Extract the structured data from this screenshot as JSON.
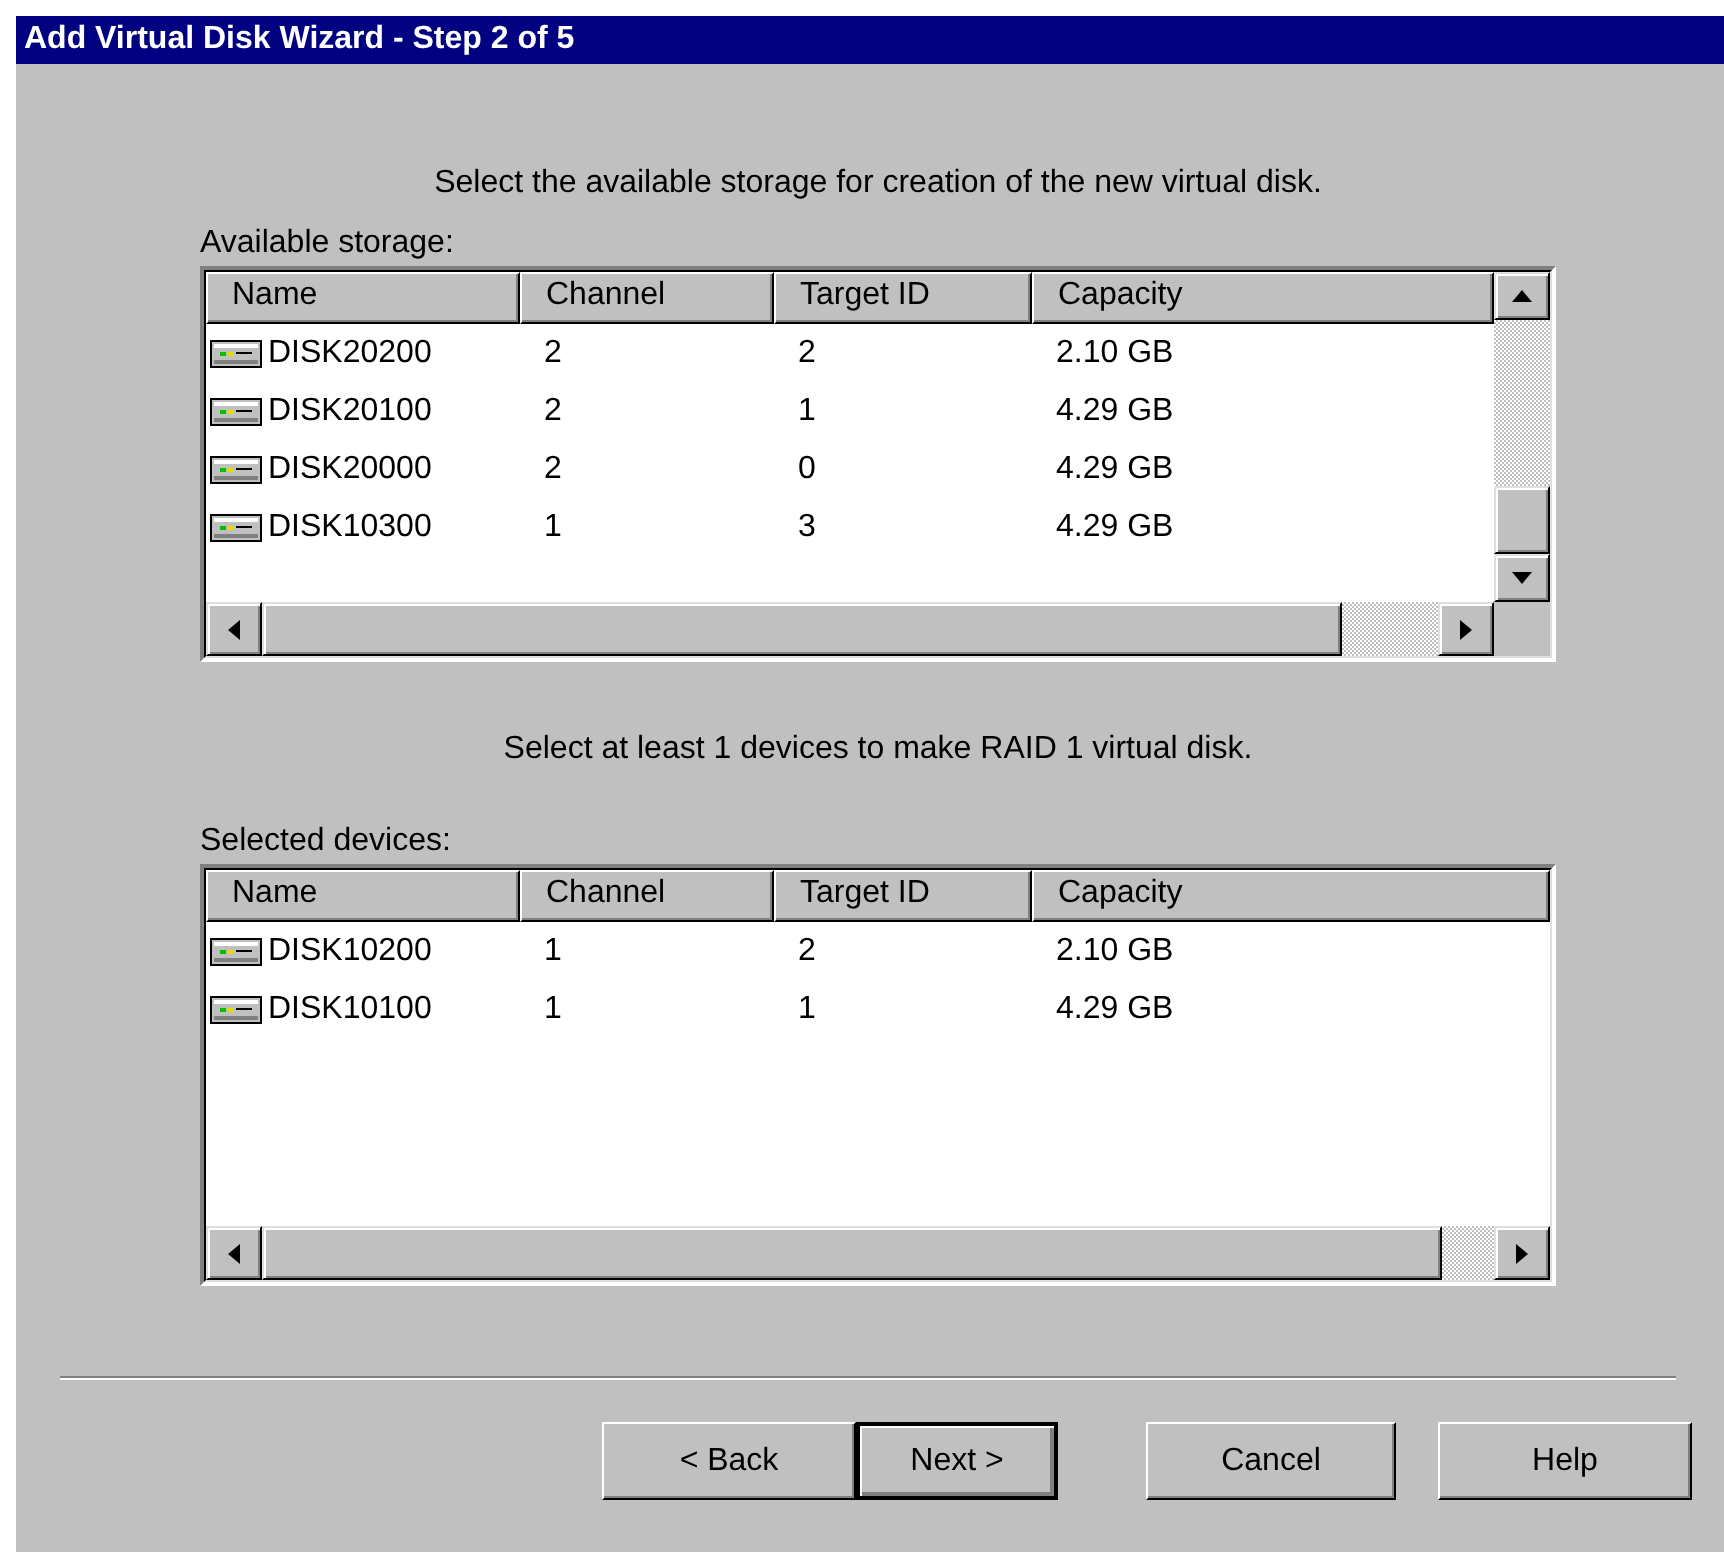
{
  "window": {
    "title": "Add Virtual Disk Wizard - Step 2 of 5"
  },
  "instruction": "Select the available storage for creation of the new virtual disk.",
  "available_storage": {
    "label": "Available storage:",
    "vertical_scrollbar": true,
    "columns": [
      "Name",
      "Channel",
      "Target ID",
      "Capacity"
    ],
    "rows": [
      {
        "name": "DISK20200",
        "channel": "2",
        "target_id": "2",
        "capacity": "2.10 GB"
      },
      {
        "name": "DISK20100",
        "channel": "2",
        "target_id": "1",
        "capacity": "4.29 GB"
      },
      {
        "name": "DISK20000",
        "channel": "2",
        "target_id": "0",
        "capacity": "4.29 GB"
      },
      {
        "name": "DISK10300",
        "channel": "1",
        "target_id": "3",
        "capacity": "4.29 GB"
      }
    ]
  },
  "hint": "Select at least 1 devices to make RAID 1 virtual disk.",
  "selected_devices": {
    "label": "Selected devices:",
    "vertical_scrollbar": false,
    "columns": [
      "Name",
      "Channel",
      "Target ID",
      "Capacity"
    ],
    "rows": [
      {
        "name": "DISK10200",
        "channel": "1",
        "target_id": "2",
        "capacity": "2.10 GB"
      },
      {
        "name": "DISK10100",
        "channel": "1",
        "target_id": "1",
        "capacity": "4.29 GB"
      }
    ]
  },
  "buttons": [
    {
      "label": "< Back",
      "default": false
    },
    {
      "label": "Next >",
      "default": true
    },
    {
      "label": "Cancel",
      "default": false
    },
    {
      "label": "Help",
      "default": false
    }
  ]
}
